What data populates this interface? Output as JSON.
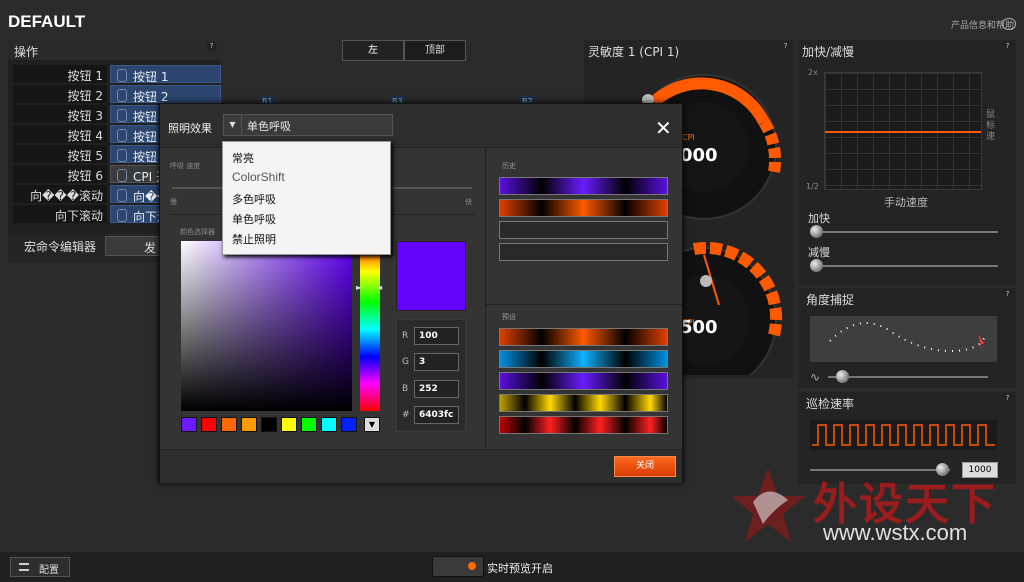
{
  "app": {
    "profile_title": "DEFAULT",
    "top_help": "产品信息和帮助"
  },
  "ops": {
    "title": "操作",
    "rows": [
      {
        "label": "按钮 1",
        "value": "按钮 1"
      },
      {
        "label": "按钮 2",
        "value": "按钮 2"
      },
      {
        "label": "按钮 3",
        "value": "按钮 3"
      },
      {
        "label": "按钮 4",
        "value": "按钮 4"
      },
      {
        "label": "按钮 5",
        "value": "按钮 5"
      },
      {
        "label": "按钮 6",
        "value": "CPI 开"
      },
      {
        "label": "向���滚动",
        "value": "向���"
      },
      {
        "label": "向下滚动",
        "value": "向下滚"
      }
    ],
    "macro_label": "宏命令编辑器",
    "macro_button": "发"
  },
  "view_tabs": {
    "left": "左",
    "top": "顶部"
  },
  "mouse_labels": [
    "B1",
    "B3",
    "B2"
  ],
  "sensitivity": {
    "title": "灵敏度 1 (CPI 1)",
    "gauge1_value": "000",
    "gauge1_unit": "CPI",
    "gauge2_value": "500",
    "gauge2_unit": "CPI"
  },
  "accel": {
    "title": "加快/减慢",
    "y_top": "2x",
    "y_bottom": "1/2",
    "right_label": "鼠标速",
    "x_label": "手动速度",
    "accel_label": "加快",
    "decel_label": "减慢"
  },
  "angle": {
    "title": "角度捕捉"
  },
  "polling": {
    "title": "巡检速率",
    "value": "1000"
  },
  "dialog": {
    "effect_label": "照明效果",
    "effect_selected": "单色呼吸",
    "dropdown_options": [
      "常亮",
      "ColorShift",
      "多色呼吸",
      "单色呼吸",
      "禁止照明"
    ],
    "rate_label": "呼吸 速度",
    "slow_label": "慢",
    "fast_label": "快",
    "picker_label": "颜色选择器",
    "rgb": {
      "r": "100",
      "g": "3",
      "b": "252",
      "hex": "6403fc"
    },
    "rgb_labels": {
      "r": "R",
      "g": "G",
      "b": "B",
      "hex": "#"
    },
    "history_label": "历史",
    "preset_label": "预设",
    "close_button": "关闭",
    "swatches": [
      "#6a1cff",
      "#ff0000",
      "#ff6a00",
      "#ff9a00",
      "#000000",
      "#ffff00",
      "#00ff00",
      "#00ffff",
      "#0022ff"
    ]
  },
  "bottom": {
    "config_label": "配置",
    "live_preview": "实时预览开启"
  },
  "watermark": {
    "text": "外设天下",
    "url": "www.wstx.com"
  },
  "colors": {
    "accent": "#ff6a00",
    "selected_color": "#6403fc"
  }
}
